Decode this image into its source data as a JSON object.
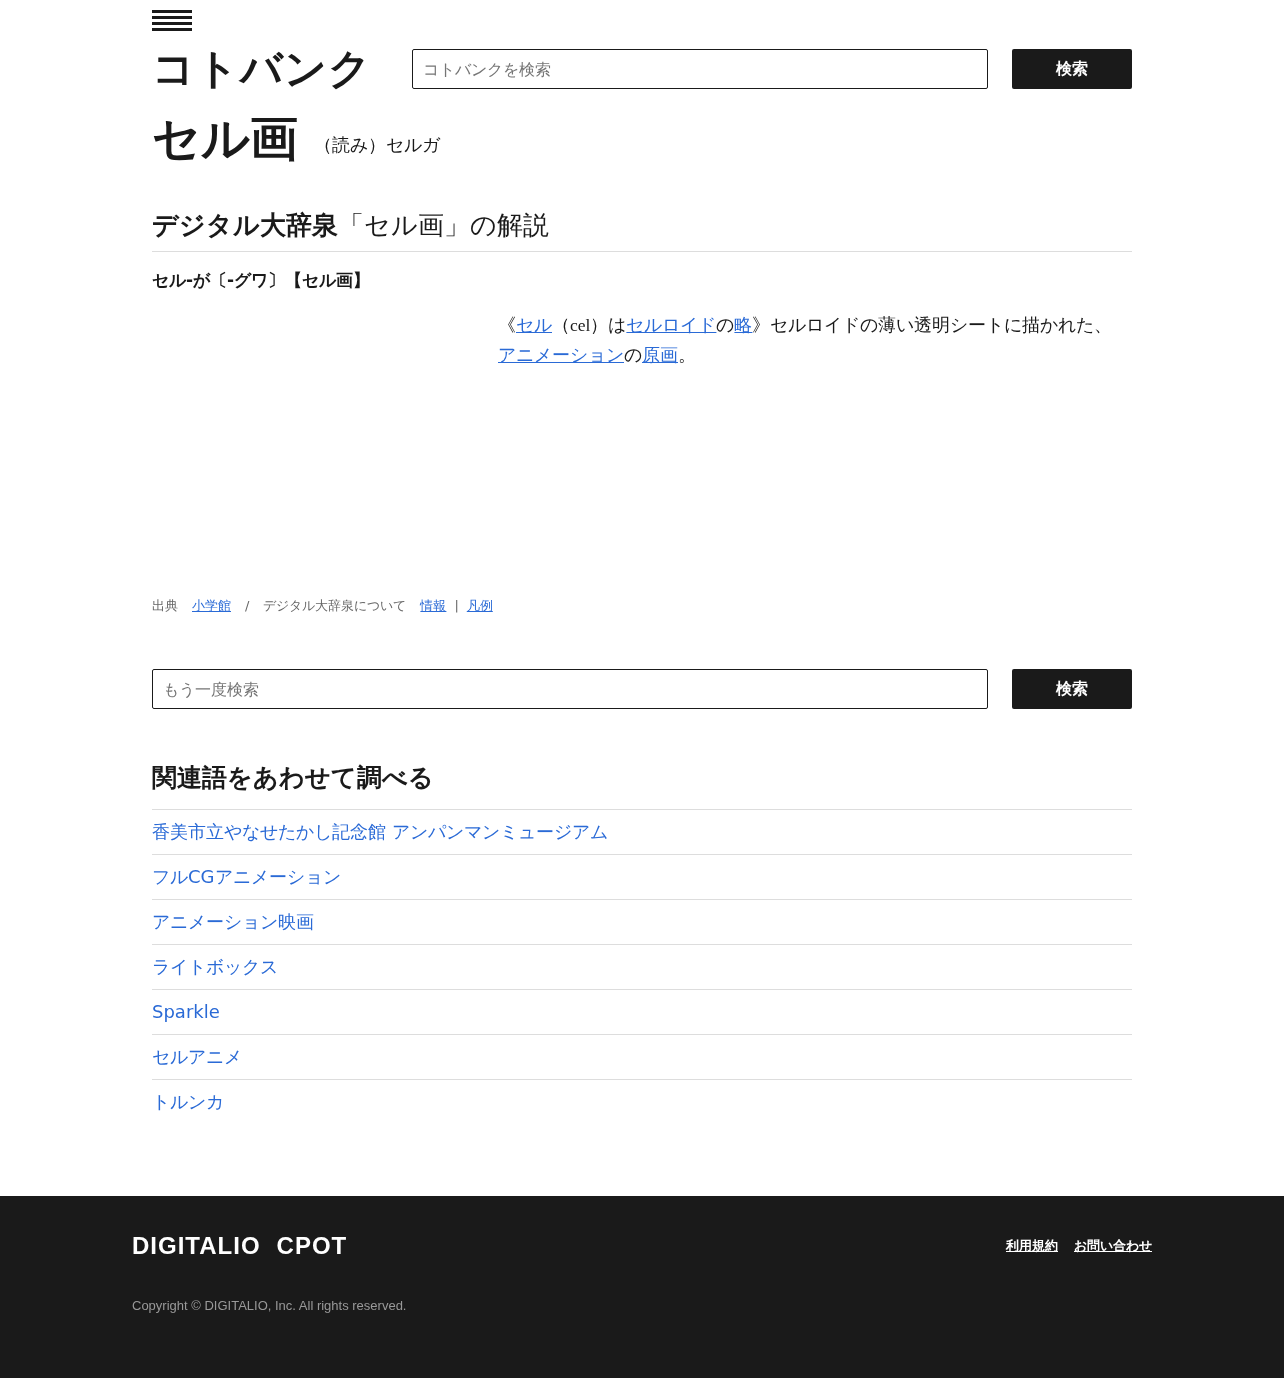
{
  "header": {
    "logo": "コトバンク",
    "search": {
      "placeholder": "コトバンクを検索",
      "button": "検索"
    }
  },
  "term": {
    "title": "セル画",
    "reading": "（読み）セルガ"
  },
  "section": {
    "dictionary": "デジタル大辞泉",
    "heading_rest": "「セル画」の解説",
    "headword": "セル-が〔-グワ〕【セル画】",
    "definition": [
      {
        "text": "《",
        "link": false
      },
      {
        "text": "セル",
        "link": true
      },
      {
        "text": "（cel）は",
        "link": false
      },
      {
        "text": "セルロイド",
        "link": true
      },
      {
        "text": "の",
        "link": false
      },
      {
        "text": "略",
        "link": true
      },
      {
        "text": "》セルロイドの薄い透明シートに描かれた、",
        "link": false
      },
      {
        "text": "アニメーション",
        "link": true
      },
      {
        "text": "の",
        "link": false
      },
      {
        "text": "原画",
        "link": true
      },
      {
        "text": "。",
        "link": false
      }
    ],
    "source": [
      {
        "text": "出典",
        "link": false
      },
      {
        "text": "小学館",
        "link": true
      },
      {
        "text": "/",
        "link": false
      },
      {
        "text": "デジタル大辞泉について",
        "link": false
      },
      {
        "text": "情報",
        "link": true
      },
      {
        "text": "|",
        "link": false
      },
      {
        "text": "凡例",
        "link": true
      }
    ]
  },
  "search_again": {
    "placeholder": "もう一度検索",
    "button": "検索"
  },
  "related": {
    "heading": "関連語をあわせて調べる",
    "items": [
      {
        "label": "香美市立やなせたかし記念館 アンパンマンミュージアム"
      },
      {
        "label": "フルCGアニメーション"
      },
      {
        "label": "アニメーション映画"
      },
      {
        "label": "ライトボックス"
      },
      {
        "label": "Sparkle"
      },
      {
        "label": "セルアニメ"
      },
      {
        "label": "トルンカ"
      }
    ]
  },
  "footer": {
    "logos": [
      "DIGITALIO",
      "CPOT"
    ],
    "links": [
      "利用規約",
      "お問い合わせ"
    ],
    "copyright": "Copyright © DIGITALIO, Inc. All rights reserved."
  }
}
